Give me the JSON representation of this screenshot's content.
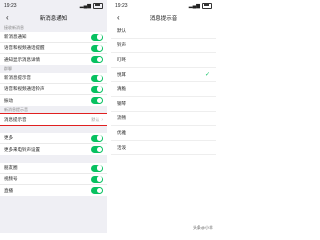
{
  "left": {
    "status": {
      "time": "19:23"
    },
    "navbar": {
      "back": "‹",
      "title": "新消息通知"
    },
    "groups": [
      {
        "label": "接收新消息",
        "rows": [
          {
            "label": "新消息通知",
            "toggle": true
          },
          {
            "label": "语音和视频通话提醒",
            "toggle": true
          },
          {
            "label": "通知显示消息详情",
            "toggle": true
          }
        ]
      },
      {
        "label": "群聊",
        "rows": [
          {
            "label": "新消息提示音",
            "toggle": true
          },
          {
            "label": "语音和视频通话铃声",
            "toggle": true
          },
          {
            "label": "振动",
            "toggle": true
          }
        ]
      },
      {
        "label": "新消息提示音",
        "rows": [
          {
            "label": "消息提示音",
            "value": "默认",
            "highlight": true
          }
        ]
      },
      {
        "label": "",
        "rows": [
          {
            "label": "更多",
            "toggle": true
          },
          {
            "label": "更多来电铃声设置",
            "toggle": true
          }
        ]
      },
      {
        "label": "",
        "rows": [
          {
            "label": "朋友圈",
            "toggle": true
          },
          {
            "label": "视频号",
            "toggle": true
          },
          {
            "label": "直播",
            "toggle": true
          }
        ]
      }
    ]
  },
  "right": {
    "status": {
      "time": "19:23"
    },
    "navbar": {
      "back": "‹",
      "title": "消息提示音"
    },
    "items": [
      {
        "label": "默认",
        "checked": false
      },
      {
        "label": "铃声",
        "checked": false
      },
      {
        "label": "叮咚",
        "checked": false
      },
      {
        "label": "悦耳",
        "checked": true
      },
      {
        "label": "清脆",
        "checked": false
      },
      {
        "label": "钢琴",
        "checked": false
      },
      {
        "label": "流畅",
        "checked": false
      },
      {
        "label": "优雅",
        "checked": false
      },
      {
        "label": "活泼",
        "checked": false
      }
    ]
  },
  "watermark": "头条@小羊",
  "colors": {
    "accent": "#07c160",
    "highlight": "#e02020"
  }
}
